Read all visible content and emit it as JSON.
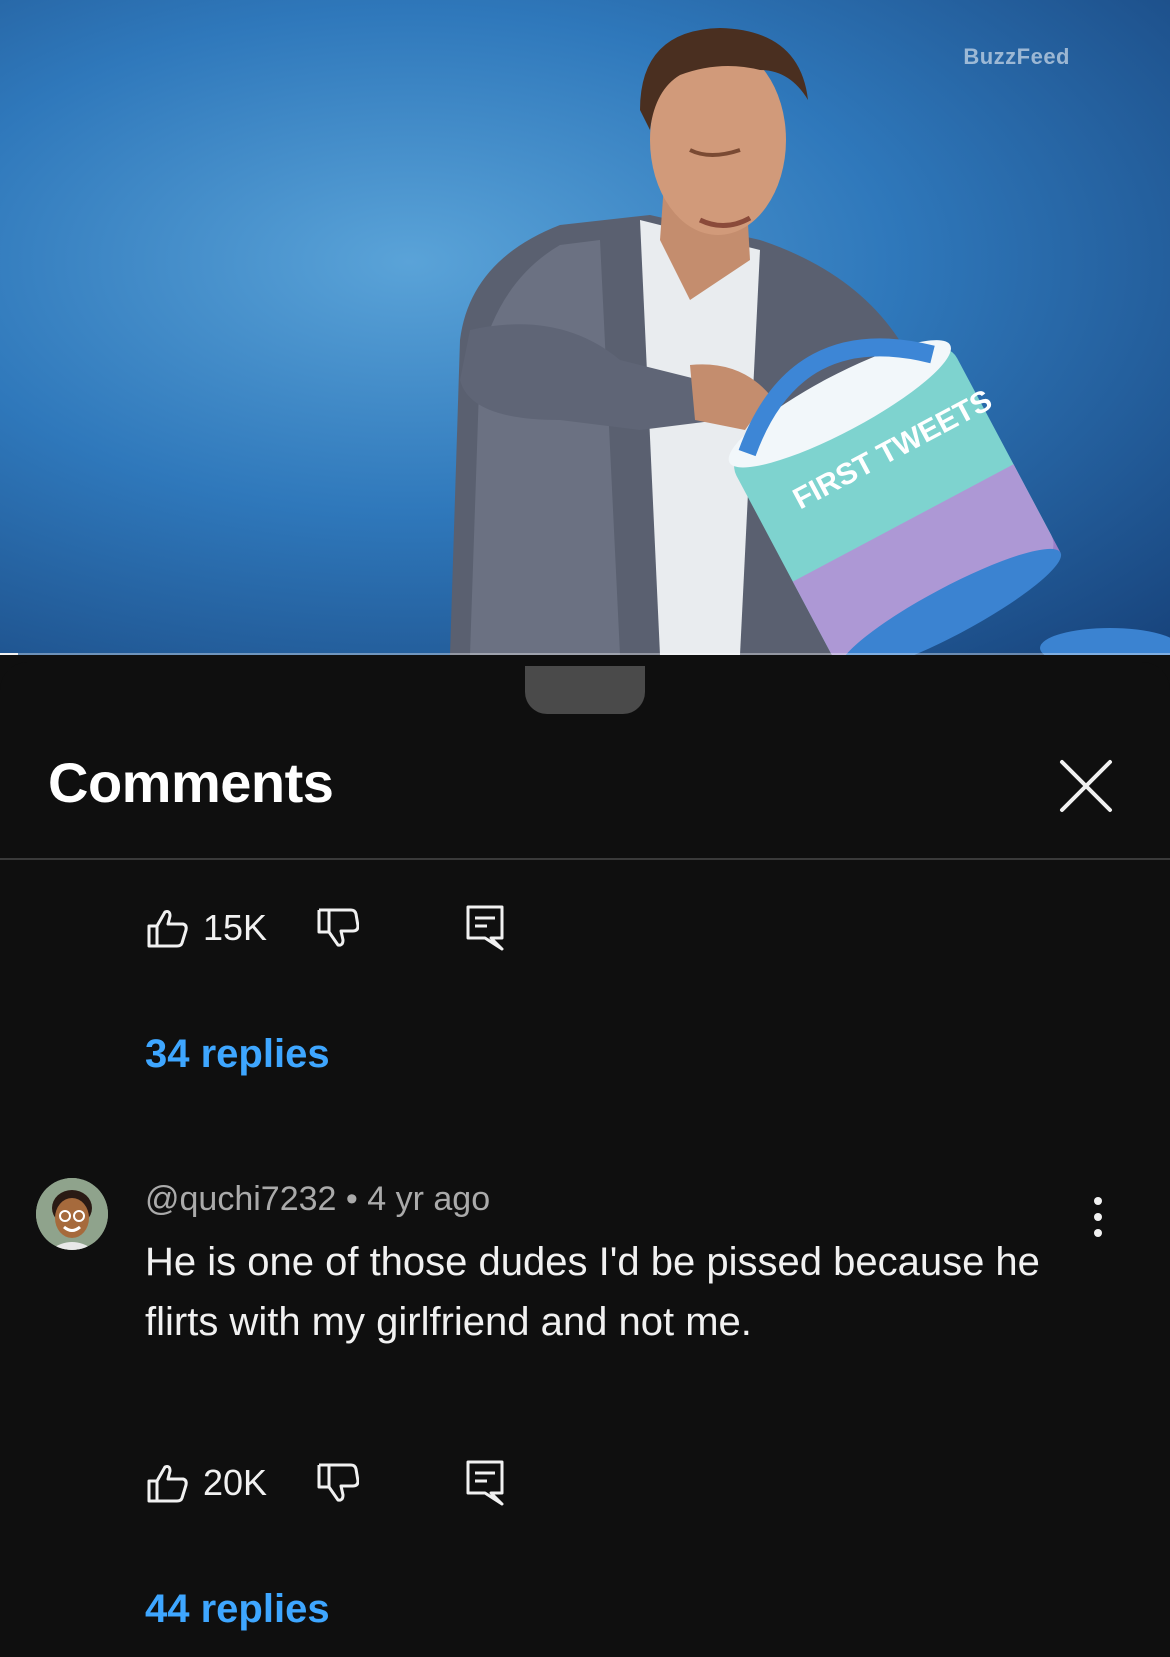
{
  "video": {
    "watermark": "BuzzFeed",
    "progress_fraction": 0.015,
    "bucket_label": "FIRST TWEETS"
  },
  "sheet": {
    "title": "Comments"
  },
  "comments": [
    {
      "likes": "15K",
      "replies": "34 replies"
    },
    {
      "author": "@quchi7232",
      "separator": "•",
      "time": "4 yr ago",
      "text": "He is one of those dudes I'd be pissed because he flirts with my girlfriend and not me.",
      "likes": "20K",
      "replies": "44 replies"
    }
  ],
  "colors": {
    "background": "#0f0f0f",
    "link": "#3ea6ff",
    "muted": "#aaaaaa",
    "text": "#f1f1f1"
  }
}
